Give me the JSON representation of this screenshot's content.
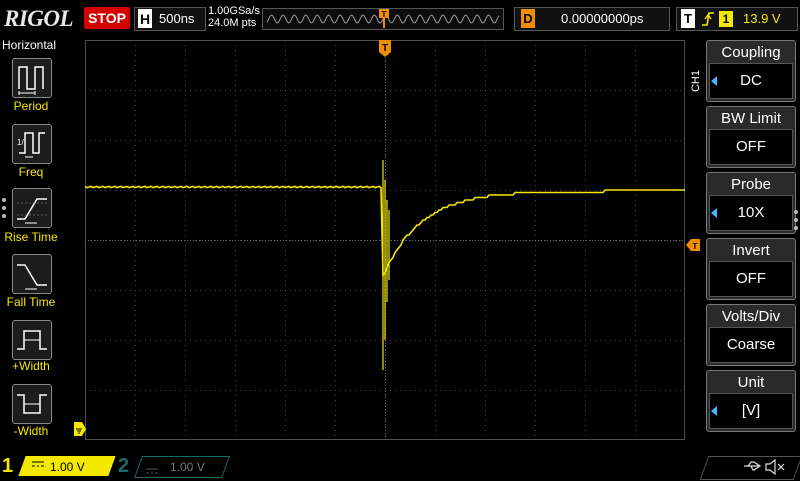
{
  "top_bar": {
    "brand": "RIGOL",
    "run_state": "STOP",
    "timebase_label": "H",
    "timebase_value": "500ns",
    "sample_rate": "1.00GSa/s",
    "memory_depth": "24.0M pts",
    "delay_label": "D",
    "delay_value": "0.00000000ps",
    "trigger_label": "T",
    "trigger_edge_icon": "rising-edge-icon",
    "trigger_source": "1",
    "trigger_level": "13.9 V"
  },
  "left_menu": {
    "title": "Horizontal",
    "items": [
      {
        "label": "Period",
        "icon": "period-icon"
      },
      {
        "label": "Freq",
        "icon": "frequency-icon"
      },
      {
        "label": "Rise Time",
        "icon": "rise-time-icon"
      },
      {
        "label": "Fall Time",
        "icon": "fall-time-icon"
      },
      {
        "label": "+Width",
        "icon": "positive-width-icon"
      },
      {
        "label": "-Width",
        "icon": "negative-width-icon"
      }
    ]
  },
  "right_menu": {
    "channel": "CH1",
    "items": [
      {
        "title": "Coupling",
        "value": "DC",
        "has_arrow": true
      },
      {
        "title": "BW Limit",
        "value": "OFF",
        "has_arrow": false
      },
      {
        "title": "Probe",
        "value": "10X",
        "has_arrow": true
      },
      {
        "title": "Invert",
        "value": "OFF",
        "has_arrow": false
      },
      {
        "title": "Volts/Div",
        "value": "Coarse",
        "has_arrow": false
      },
      {
        "title": "Unit",
        "value": "[V]",
        "has_arrow": true
      }
    ]
  },
  "bottom_bar": {
    "ch1_number": "1",
    "ch1_scale": "1.00 V",
    "ch2_number": "2",
    "ch2_scale": "1.00 V"
  },
  "markers": {
    "trigger_position": "T"
  },
  "colors": {
    "ch1": "#f5e800",
    "trigger_marker": "#f18d00",
    "stop": "#d40000",
    "grid": "#3a3a3a"
  }
}
